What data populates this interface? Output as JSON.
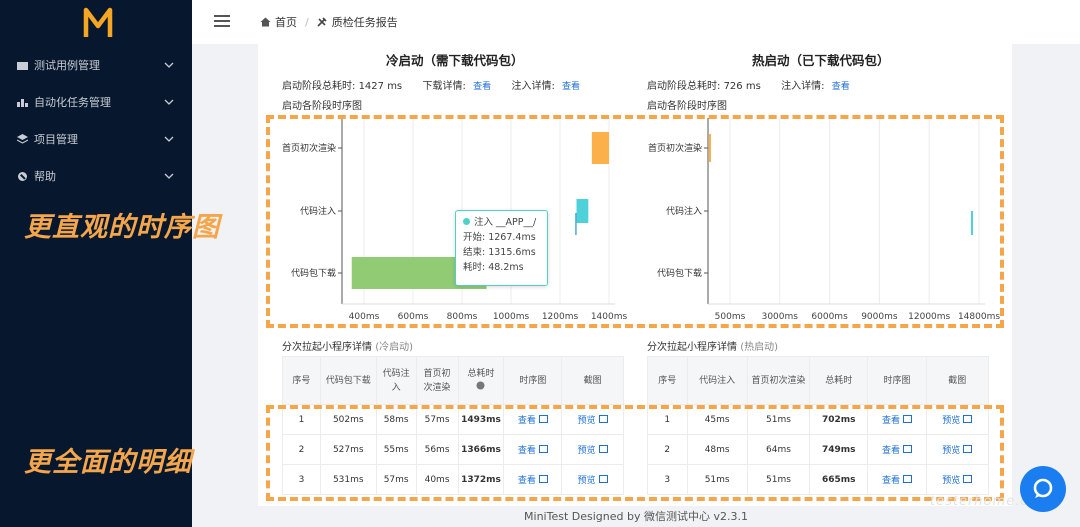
{
  "sidebar": {
    "logo": "M",
    "items": [
      {
        "label": "测试用例管理",
        "icon": "folder-icon"
      },
      {
        "label": "自动化任务管理",
        "icon": "bar-chart-icon"
      },
      {
        "label": "项目管理",
        "icon": "layers-icon"
      },
      {
        "label": "帮助",
        "icon": "help-icon"
      }
    ]
  },
  "header": {
    "breadcrumbs": [
      "首页",
      "质检任务报告"
    ]
  },
  "cold": {
    "title": "冷启动（需下载代码包）",
    "total_label": "启动阶段总耗时:",
    "total_value": "1427 ms",
    "download_label": "下载详情:",
    "inject_label": "注入详情:",
    "view_link": "查看",
    "chart_title": "启动各阶段时序图",
    "table_title": "分次拉起小程序详情",
    "table_tag": "(冷启动)"
  },
  "hot": {
    "title": "热启动（已下载代码包）",
    "total_label": "启动阶段总耗时:",
    "total_value": "726 ms",
    "inject_label": "注入详情:",
    "view_link": "查看",
    "chart_title": "启动各阶段时序图",
    "table_title": "分次拉起小程序详情",
    "table_tag": "(热启动)"
  },
  "chart_data": [
    {
      "type": "bar",
      "title": "启动各阶段时序图",
      "categories": [
        "首页初次渲染",
        "代码注入",
        "代码包下载"
      ],
      "x_ticks": [
        "400ms",
        "600ms",
        "800ms",
        "1000ms",
        "1200ms",
        "1400ms"
      ],
      "xlim": [
        300,
        1500
      ],
      "series": [
        {
          "name": "代码包下载",
          "start": 350,
          "end": 900,
          "color": "#91cc75"
        },
        {
          "name": "注入 __APP__/",
          "start": 1267.4,
          "end": 1315.6,
          "color": "#4fd1d9"
        },
        {
          "name": "首页初次渲染",
          "start": 1330,
          "end": 1400,
          "color": "#fbb04a"
        }
      ]
    },
    {
      "type": "bar",
      "title": "启动各阶段时序图",
      "categories": [
        "首页初次渲染",
        "代码注入",
        "代码包下载"
      ],
      "x_ticks": [
        "500ms",
        "3000ms",
        "6000ms",
        "9000ms",
        "12000ms",
        "14800ms"
      ],
      "series": [
        {
          "name": "代码注入",
          "color": "#4fd1d9"
        },
        {
          "name": "首页初次渲染",
          "color": "#fbb04a"
        }
      ]
    }
  ],
  "tooltip": {
    "title": "注入 __APP__/",
    "start": "开始: 1267.4ms",
    "end": "结束: 1315.6ms",
    "cost": "耗时: 48.2ms"
  },
  "cold_table": {
    "headers": [
      "序号",
      "代码包下载",
      "代码注入",
      "首页初次渲染",
      "总耗时",
      "时序图",
      "截图"
    ],
    "rows": [
      [
        "1",
        "502ms",
        "58ms",
        "57ms",
        "1493ms",
        "查看",
        "预览"
      ],
      [
        "2",
        "527ms",
        "55ms",
        "56ms",
        "1366ms",
        "查看",
        "预览"
      ],
      [
        "3",
        "531ms",
        "57ms",
        "40ms",
        "1372ms",
        "查看",
        "预览"
      ]
    ]
  },
  "hot_table": {
    "headers": [
      "序号",
      "代码注入",
      "首页初次渲染",
      "总耗时",
      "时序图",
      "截图"
    ],
    "rows": [
      [
        "1",
        "45ms",
        "51ms",
        "702ms",
        "查看",
        "预览"
      ],
      [
        "2",
        "48ms",
        "64ms",
        "749ms",
        "查看",
        "预览"
      ],
      [
        "3",
        "51ms",
        "51ms",
        "665ms",
        "查看",
        "预览"
      ]
    ]
  },
  "captions": {
    "timeline": "更直观的时序图",
    "detail": "更全面的明细"
  },
  "footer": "MiniTest Designed by 微信测试中心 v2.3.1",
  "watermark": "testerhome.com"
}
